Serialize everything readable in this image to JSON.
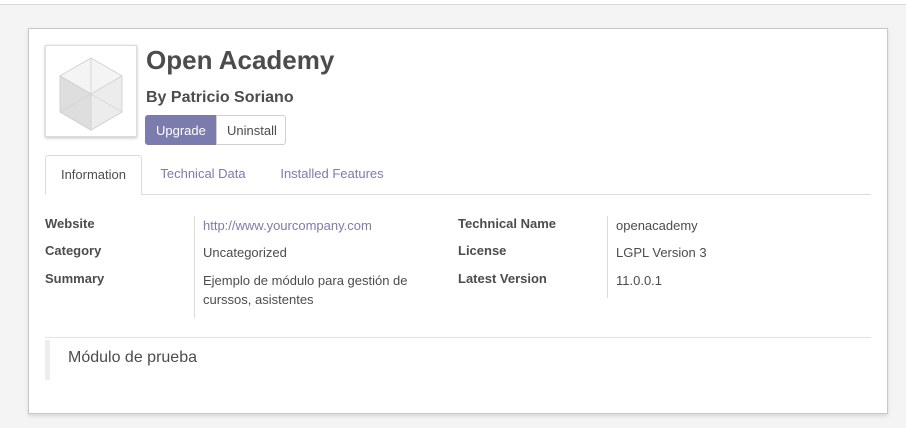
{
  "module": {
    "name": "Open Academy",
    "author": "By Patricio Soriano",
    "icon": "module-cube-icon"
  },
  "buttons": {
    "upgrade": "Upgrade",
    "uninstall": "Uninstall"
  },
  "tabs": [
    {
      "label": "Information",
      "active": true
    },
    {
      "label": "Technical Data",
      "active": false
    },
    {
      "label": "Installed Features",
      "active": false
    }
  ],
  "info": {
    "website_label": "Website",
    "website_value": "http://www.yourcompany.com",
    "category_label": "Category",
    "category_value": "Uncategorized",
    "summary_label": "Summary",
    "summary_value": "Ejemplo de módulo para gestión de curssos, asistentes",
    "technical_name_label": "Technical Name",
    "technical_name_value": "openacademy",
    "license_label": "License",
    "license_value": "LGPL Version 3",
    "latest_version_label": "Latest Version",
    "latest_version_value": "11.0.0.1"
  },
  "description": "Módulo de prueba",
  "colors": {
    "accent": "#7c7bad",
    "text": "#4c4c4c",
    "background": "#f4f4f4"
  }
}
